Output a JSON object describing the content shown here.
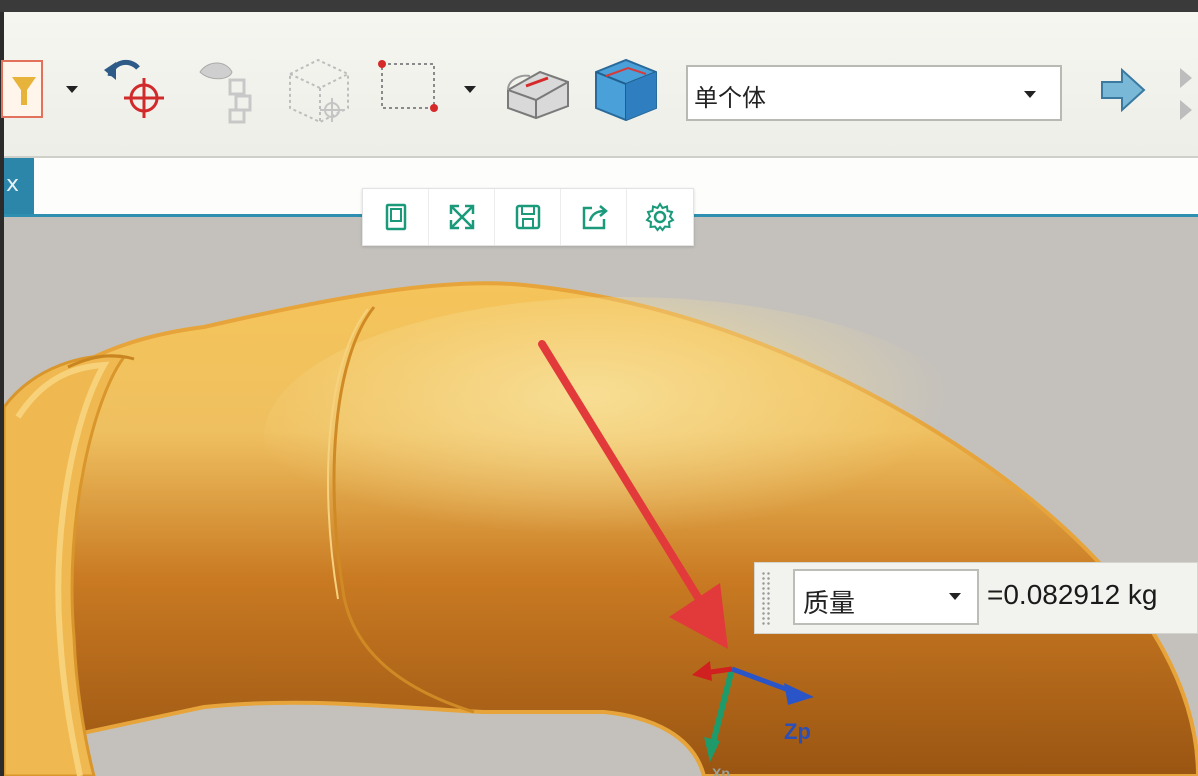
{
  "toolbar": {
    "body_select": {
      "value": "单个体"
    }
  },
  "tabbar": {
    "close_glyph": "x"
  },
  "mini_toolbar": {
    "buttons": [
      "select-page-icon",
      "fit-view-icon",
      "save-icon",
      "share-icon",
      "gear-icon"
    ]
  },
  "measure": {
    "type_select": "质量",
    "result": "=0.082912 kg"
  },
  "triad": {
    "z_label": "Zp",
    "x_label": "Xp"
  },
  "colors": {
    "part": "#e7a63a",
    "annotation_arrow": "#e23a3a",
    "accent": "#1a9a7a",
    "tab_active": "#2b86a9"
  }
}
